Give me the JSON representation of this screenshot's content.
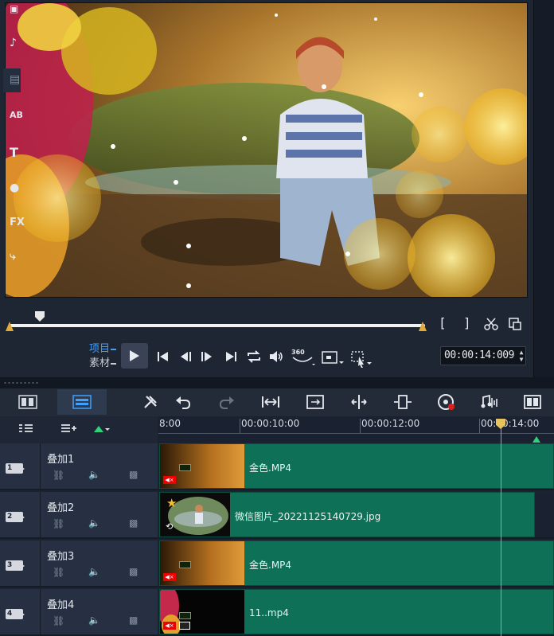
{
  "preview": {
    "mode_project": "项目",
    "mode_clip": "素材",
    "timecode": "00:00:14:009",
    "bracket_in": "[",
    "bracket_out": "]",
    "btn_360": "360"
  },
  "sidebar": {
    "icons": [
      "media-icon",
      "audio-icon",
      "instant-project-icon",
      "transition-icon",
      "title-icon",
      "graphics-icon",
      "filter-icon",
      "path-icon"
    ],
    "labels": [
      "AB",
      "T",
      "FX"
    ]
  },
  "ruler": {
    "labels": [
      "8:00",
      "00:00:10:00",
      "00:00:12:00",
      "00:00:14:00"
    ]
  },
  "tracks": [
    {
      "num": "1",
      "name": "叠加1",
      "clip": "金色.MP4"
    },
    {
      "num": "2",
      "name": "叠加2",
      "clip": "微信图片_20221125140729.jpg"
    },
    {
      "num": "3",
      "name": "叠加3",
      "clip": "金色.MP4"
    },
    {
      "num": "4",
      "name": "叠加4",
      "clip": "11..mp4"
    }
  ],
  "colors": {
    "accent_blue": "#3fa0ff",
    "clip_green": "#0e7057",
    "trim_orange": "#e3a93a",
    "playhead_yellow": "#e6c35c"
  }
}
